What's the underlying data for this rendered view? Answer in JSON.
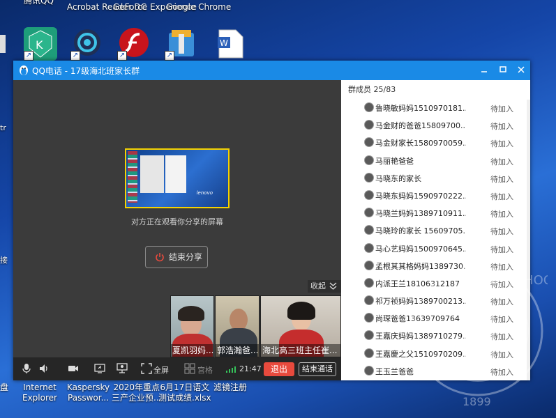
{
  "desktop": {
    "top_labels": [
      "腾讯QQ",
      "Acrobat Reader DC",
      "GeForce Experience",
      "Google Chrome"
    ],
    "left_edge": [
      "tr",
      "接"
    ],
    "bottom_icons": [
      {
        "line1": "Internet",
        "line2": "Explorer"
      },
      {
        "line1": "Kaspersky",
        "line2": "Passwor..."
      },
      {
        "line1": "2020年重点",
        "line2": "三产企业预..."
      },
      {
        "line1": "6月17日语文",
        "line2": "测试成绩.xlsx"
      },
      {
        "line1": "滤镜注册",
        "line2": ""
      }
    ],
    "left_bottom_label": "盘"
  },
  "window": {
    "title": "QQ电话 - 17级海北班家长群",
    "share_caption": "对方正在观看你分享的屏幕",
    "thumb_brand": "lenovo",
    "end_share_label": "结束分享",
    "collapse_label": "收起",
    "participants": [
      "夏凯羽妈...",
      "郭浩瀚爸...",
      "海北高三班主任崔..."
    ],
    "toolbar": {
      "fullscreen_label": "全屏",
      "gallery_label": "宫格",
      "call_time": "21:47",
      "exit_label": "退出",
      "end_call_label": "结束通话"
    },
    "colors": {
      "titlebar": "#1a8ae6",
      "exit": "#e84a3d",
      "share_border": "#f5d200"
    }
  },
  "members": {
    "title": "群成员 25/83",
    "list": [
      {
        "name": "鲁晓敏妈妈1510970181...",
        "status": "待加入"
      },
      {
        "name": "马金财的爸爸15809700...",
        "status": "待加入"
      },
      {
        "name": "马金财家长1580970059...",
        "status": "待加入"
      },
      {
        "name": "马丽艳爸爸",
        "status": "待加入"
      },
      {
        "name": "马晓东的家长",
        "status": "待加入"
      },
      {
        "name": "马晓东妈妈1590970222...",
        "status": "待加入"
      },
      {
        "name": "马晓兰妈妈1389710911...",
        "status": "待加入"
      },
      {
        "name": "马晓玲的家长 15609705...",
        "status": "待加入"
      },
      {
        "name": "马心艺妈妈1500970645...",
        "status": "待加入"
      },
      {
        "name": "孟根其其格妈妈1389730...",
        "status": "待加入"
      },
      {
        "name": "内派王兰18106312187",
        "status": "待加入"
      },
      {
        "name": "祁万祯妈妈1389700213...",
        "status": "待加入"
      },
      {
        "name": "尚琛爸爸13639709764",
        "status": "待加入"
      },
      {
        "name": "王嘉庆妈妈1389710279...",
        "status": "待加入"
      },
      {
        "name": "王嘉慶之父1510970209...",
        "status": "待加入"
      },
      {
        "name": "王玉兰爸爸",
        "status": "待加入"
      }
    ]
  },
  "seal": {
    "text": "HIGH SCHOOL",
    "year": "1899"
  }
}
